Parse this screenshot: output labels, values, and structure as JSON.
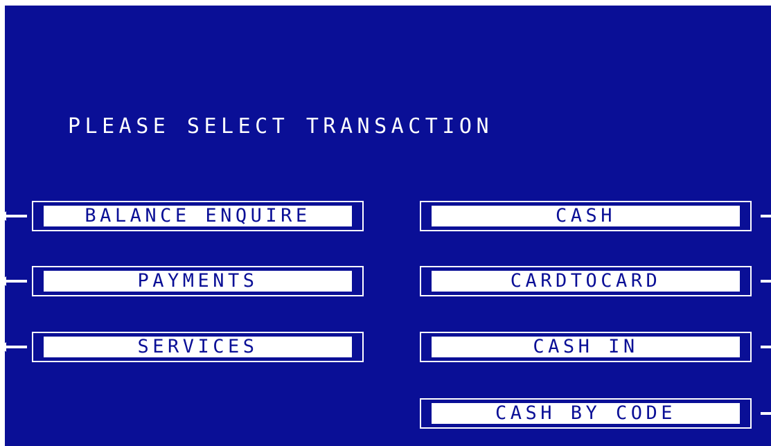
{
  "screen": {
    "title": "PLEASE SELECT TRANSACTION"
  },
  "left_options": [
    {
      "label": "BALANCE ENQUIRE"
    },
    {
      "label": "PAYMENTS"
    },
    {
      "label": "SERVICES"
    }
  ],
  "right_options": [
    {
      "label": "CASH"
    },
    {
      "label": "CARDTOCARD"
    },
    {
      "label": "CASH IN"
    },
    {
      "label": "CASH BY CODE"
    }
  ],
  "colors": {
    "background": "#0a0f96",
    "foreground": "#ffffff"
  },
  "icons": {
    "left_indicator": "arrow-left-icon",
    "right_indicator": "function-key-marker-icon"
  }
}
